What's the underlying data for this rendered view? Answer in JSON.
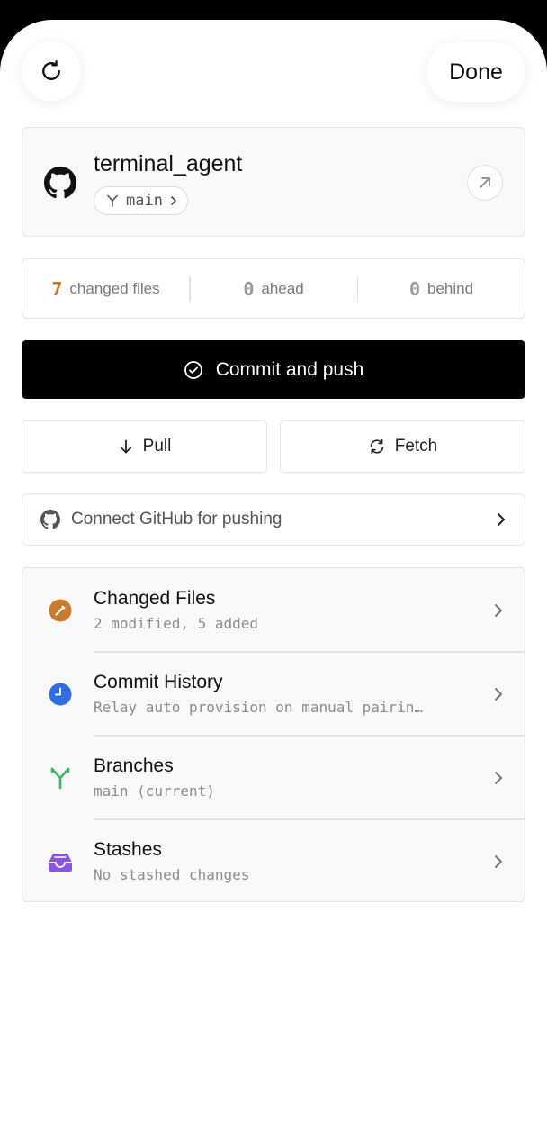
{
  "header": {
    "refresh_icon": "refresh-icon",
    "done_label": "Done"
  },
  "repo": {
    "name": "terminal_agent",
    "branch": "main",
    "icons": [
      "github-icon",
      "branch-icon",
      "chevron-right-icon",
      "arrow-up-right-icon"
    ]
  },
  "stats": {
    "changed_count": "7",
    "changed_label": "changed files",
    "ahead_count": "0",
    "ahead_label": "ahead",
    "behind_count": "0",
    "behind_label": "behind"
  },
  "actions": {
    "commit_push_label": "Commit and push",
    "pull_label": "Pull",
    "fetch_label": "Fetch",
    "connect_label": "Connect GitHub for pushing"
  },
  "sections": [
    {
      "title": "Changed Files",
      "subtitle": "2 modified, 5 added",
      "icon": "pencil-circle-icon",
      "color": "#c97a2c"
    },
    {
      "title": "Commit History",
      "subtitle": "Relay auto provision on manual pairin…",
      "icon": "clock-icon",
      "color": "#2f6fe4"
    },
    {
      "title": "Branches",
      "subtitle": "main (current)",
      "icon": "branch-icon",
      "color": "#3fb46a"
    },
    {
      "title": "Stashes",
      "subtitle": "No stashed changes",
      "icon": "tray-icon",
      "color": "#8a55e0"
    }
  ],
  "colors": {
    "accent_orange": "#c97a2c",
    "primary_button": "#000000"
  }
}
